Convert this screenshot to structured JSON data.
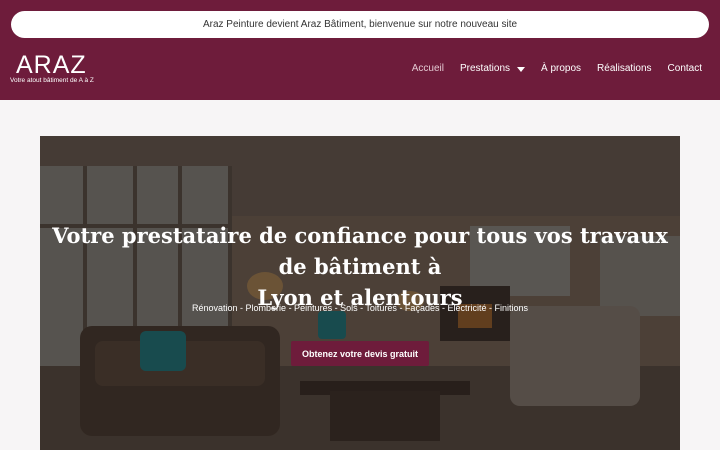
{
  "announcement": "Araz Peinture devient Araz Bâtiment, bienvenue sur notre nouveau site",
  "brand": {
    "name": "ARAZ",
    "tagline": "Votre atout bâtiment de A à Z"
  },
  "nav": {
    "items": [
      {
        "label": "Accueil",
        "active": true
      },
      {
        "label": "Prestations",
        "dropdown": true
      },
      {
        "label": "À propos"
      },
      {
        "label": "Réalisations"
      },
      {
        "label": "Contact"
      }
    ]
  },
  "hero": {
    "title_line1": "Votre prestataire de confiance pour tous vos travaux de bâtiment à",
    "title_line2": "Lyon et alentours",
    "services": "Rénovation - Plomberie - Peintures - Sols - Toitures - Façades - Electricité - Finitions",
    "cta_label": "Obtenez votre devis gratuit"
  },
  "colors": {
    "brand": "#6e1c3b",
    "accent_cushion": "#1d7f86"
  }
}
